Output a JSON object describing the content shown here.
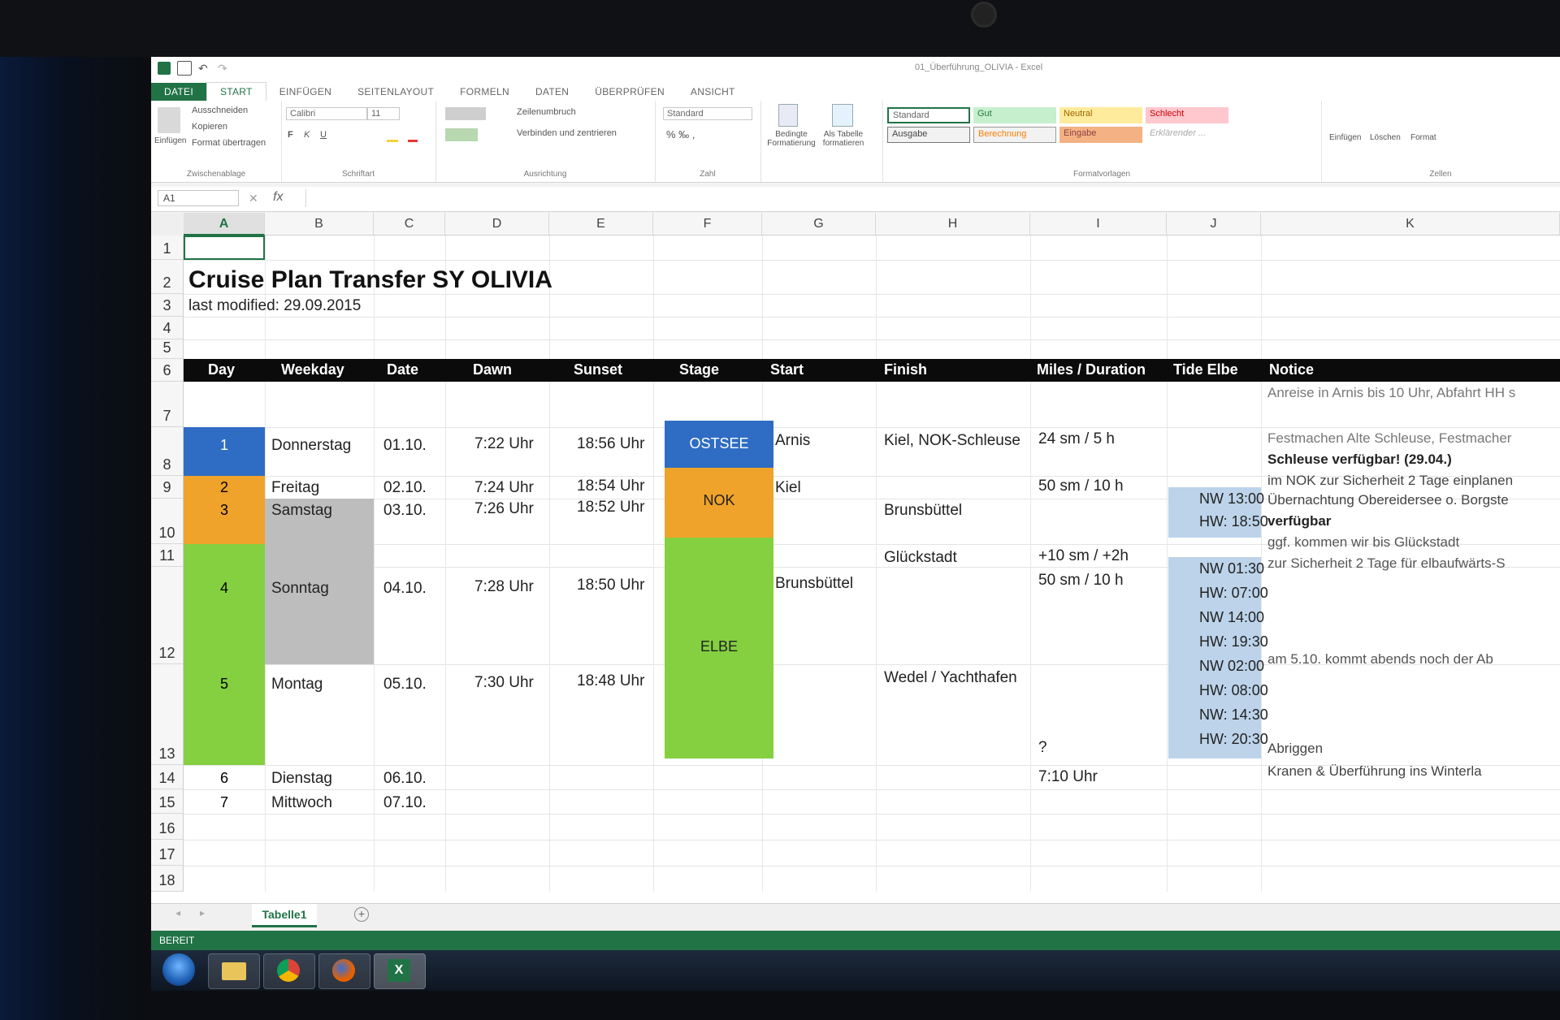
{
  "window": {
    "title": "01_Überführung_OLIVIA - Excel"
  },
  "ribbon": {
    "tabs": [
      "DATEI",
      "START",
      "EINFÜGEN",
      "SEITENLAYOUT",
      "FORMELN",
      "DATEN",
      "ÜBERPRÜFEN",
      "ANSICHT"
    ],
    "clipboard": {
      "paste": "Einfügen",
      "cut": "Ausschneiden",
      "copy": "Kopieren",
      "format_painter": "Format übertragen",
      "label": "Zwischenablage"
    },
    "font": {
      "name": "Calibri",
      "size": "11",
      "bold": "F",
      "italic": "K",
      "underline": "U",
      "label": "Schriftart"
    },
    "alignment": {
      "wrap": "Zeilenumbruch",
      "merge": "Verbinden und zentrieren",
      "label": "Ausrichtung"
    },
    "number": {
      "format": "Standard",
      "label": "Zahl"
    },
    "styles": {
      "conditional": "Bedingte Formatierung",
      "as_table": "Als Tabelle formatieren",
      "cells": [
        "Standard",
        "Gut",
        "Neutral",
        "Schlecht",
        "Ausgabe",
        "Berechnung",
        "Eingabe",
        "Erklärender ..."
      ],
      "label": "Formatvorlagen"
    },
    "cells_group": {
      "insert": "Einfügen",
      "delete": "Löschen",
      "format": "Format",
      "label": "Zellen"
    }
  },
  "formula_bar": {
    "name_box": "A1",
    "fx": "fx"
  },
  "columns": [
    "A",
    "B",
    "C",
    "D",
    "E",
    "F",
    "G",
    "H",
    "I",
    "J",
    "K"
  ],
  "rows": [
    "1",
    "2",
    "3",
    "4",
    "5",
    "6",
    "7",
    "8",
    "9",
    "10",
    "11",
    "12",
    "13",
    "14",
    "15",
    "16",
    "17",
    "18"
  ],
  "sheet": {
    "title": "Cruise Plan Transfer SY OLIVIA",
    "modified": "last modified: 29.09.2015",
    "headers": [
      "Day",
      "Weekday",
      "Date",
      "Dawn",
      "Sunset",
      "Stage",
      "Start",
      "Finish",
      "Miles / Duration",
      "Tide Elbe",
      "Notice"
    ],
    "days": [
      {
        "day": "1",
        "weekday": "Donnerstag",
        "date": "01.10.",
        "dawn": "7:22 Uhr",
        "sunset": "18:56 Uhr"
      },
      {
        "day": "2",
        "weekday": "Freitag",
        "date": "02.10.",
        "dawn": "7:24 Uhr",
        "sunset": "18:54 Uhr"
      },
      {
        "day": "3",
        "weekday": "Samstag",
        "date": "03.10.",
        "dawn": "7:26 Uhr",
        "sunset": "18:52 Uhr"
      },
      {
        "day": "4",
        "weekday": "Sonntag",
        "date": "04.10.",
        "dawn": "7:28 Uhr",
        "sunset": "18:50 Uhr"
      },
      {
        "day": "5",
        "weekday": "Montag",
        "date": "05.10.",
        "dawn": "7:30 Uhr",
        "sunset": "18:48 Uhr"
      },
      {
        "day": "6",
        "weekday": "Dienstag",
        "date": "06.10."
      },
      {
        "day": "7",
        "weekday": "Mittwoch",
        "date": "07.10."
      }
    ],
    "stages": {
      "ostsee": "OSTSEE",
      "nok": "NOK",
      "elbe": "ELBE"
    },
    "start": [
      "Arnis",
      "Kiel",
      "Brunsbüttel"
    ],
    "finish": [
      "Kiel, NOK-Schleuse",
      "Brunsbüttel",
      "Glückstadt",
      "Wedel / Yachthafen"
    ],
    "miles": [
      "24 sm / 5 h",
      "50 sm / 10 h",
      "+10 sm / +2h",
      "50 sm / 10 h",
      "?",
      "7:10 Uhr"
    ],
    "tides": [
      "NW 13:00",
      "HW: 18:50",
      "NW 01:30",
      "HW: 07:00",
      "NW 14:00",
      "HW: 19:30",
      "NW 02:00",
      "HW: 08:00",
      "NW: 14:30",
      "HW: 20:30"
    ],
    "notices": [
      "Anreise in Arnis bis 10 Uhr, Abfahrt HH s",
      "Festmachen Alte Schleuse, Festmacher",
      "Schleuse verfügbar! (29.04.)",
      "im NOK zur Sicherheit 2 Tage einplanen",
      "Übernachtung Obereidersee o. Borgste",
      "verfügbar",
      "ggf. kommen wir bis Glückstadt",
      "zur Sicherheit 2 Tage für elbaufwärts-S",
      "am 5.10. kommt abends noch der Ab",
      "Abriggen",
      "Kranen & Überführung ins Winterla"
    ]
  },
  "sheet_tab": "Tabelle1",
  "status": "BEREIT",
  "colors": {
    "excel_green": "#217346",
    "blue": "#2f6cc4",
    "orange": "#efa32a",
    "green": "#84d040",
    "gray": "#bdbdbd",
    "tide": "#bcd3ea"
  }
}
